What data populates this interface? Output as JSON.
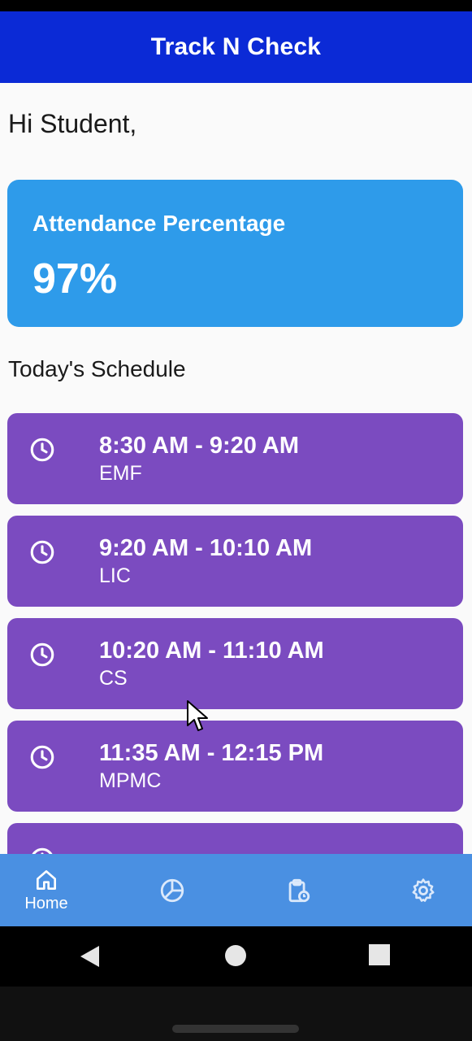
{
  "app": {
    "title": "Track N Check"
  },
  "home": {
    "greeting": "Hi Student,",
    "attendance": {
      "label": "Attendance Percentage",
      "value": "97%"
    },
    "schedule_heading": "Today's Schedule",
    "schedule": [
      {
        "time": "8:30 AM - 9:20 AM",
        "subject": "EMF",
        "icon": "clock-icon"
      },
      {
        "time": "9:20 AM - 10:10 AM",
        "subject": "LIC",
        "icon": "clock-icon"
      },
      {
        "time": "10:20 AM - 11:10 AM",
        "subject": "CS",
        "icon": "clock-icon"
      },
      {
        "time": "11:35 AM - 12:15 PM",
        "subject": "MPMC",
        "icon": "clock-icon"
      }
    ]
  },
  "bottom_nav": {
    "items": [
      {
        "label": "Home",
        "icon": "home-icon",
        "active": true
      },
      {
        "label": "",
        "icon": "pie-chart-icon",
        "active": false
      },
      {
        "label": "",
        "icon": "clipboard-icon",
        "active": false
      },
      {
        "label": "",
        "icon": "gear-icon",
        "active": false
      }
    ]
  },
  "colors": {
    "app_bar": "#0b2ad6",
    "attendance_card": "#2e9bea",
    "schedule_card": "#7b4bc0",
    "bottom_nav": "#4a90e2"
  }
}
